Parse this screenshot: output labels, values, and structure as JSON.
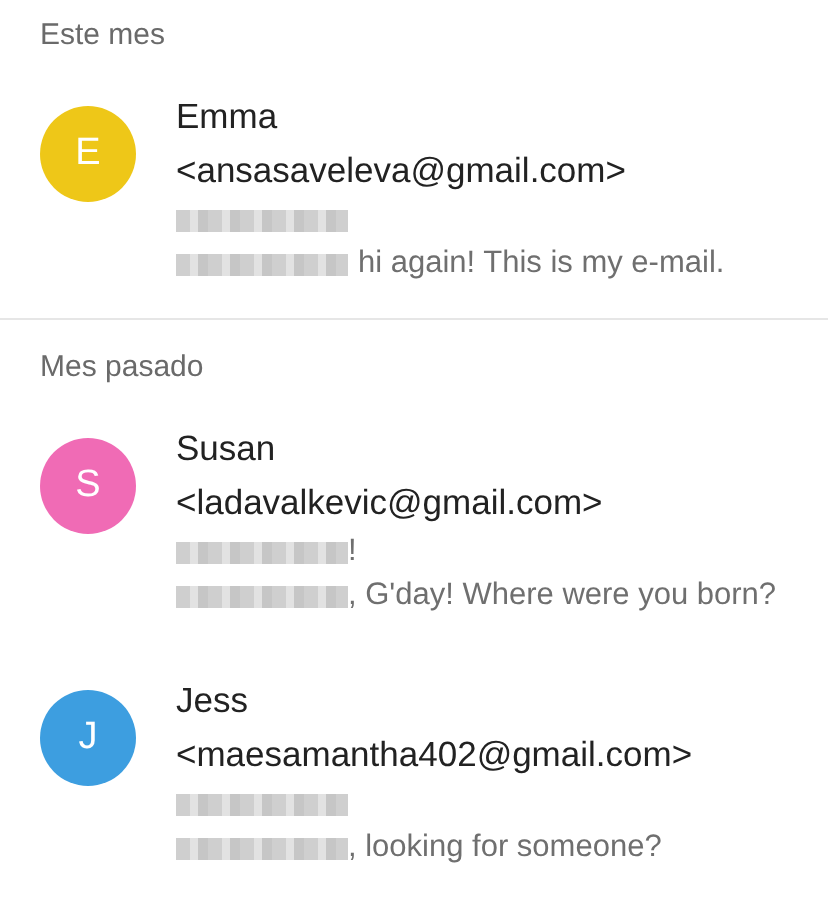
{
  "sections": [
    {
      "title": "Este mes",
      "contacts": [
        {
          "initial": "E",
          "color": "#eec718",
          "name": "Emma",
          "email": "<ansasaveleva@gmail.com>",
          "preview": "hi again! This is my e-mail.",
          "preview_joined": false
        }
      ]
    },
    {
      "title": "Mes pasado",
      "contacts": [
        {
          "initial": "S",
          "color": "#f06bb5",
          "name": "Susan",
          "email": "<ladavalkevic@gmail.com>",
          "subject_suffix": "!",
          "preview": ", G'day! Where were you born?",
          "preview_joined": true
        },
        {
          "initial": "J",
          "color": "#3d9ee0",
          "name": "Jess",
          "email": "<maesamantha402@gmail.com>",
          "preview": ", looking for someone?",
          "preview_joined": true
        }
      ]
    }
  ]
}
